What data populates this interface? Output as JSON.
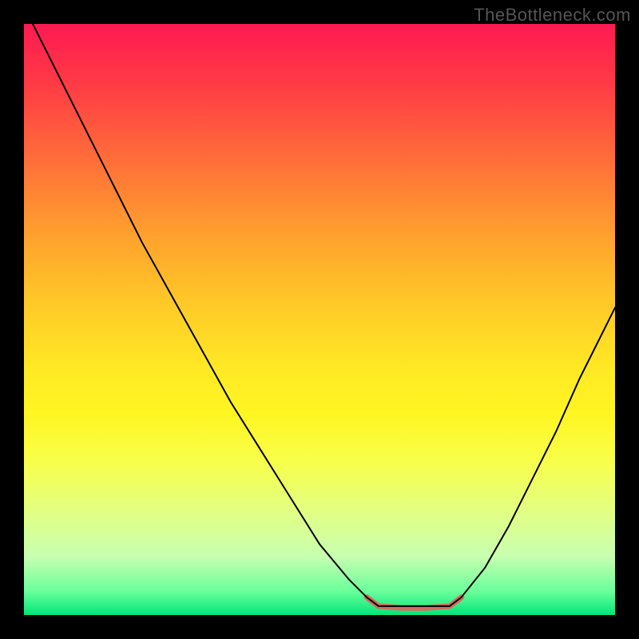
{
  "watermark": "TheBottleneck.com",
  "chart_data": {
    "type": "line",
    "title": "",
    "xlabel": "",
    "ylabel": "",
    "xlim": [
      0,
      100
    ],
    "ylim": [
      0,
      100
    ],
    "legend": null,
    "gradient_stops": [
      {
        "pos": 0,
        "color": "#ff1a52"
      },
      {
        "pos": 10,
        "color": "#ff3a45"
      },
      {
        "pos": 22,
        "color": "#ff6a3a"
      },
      {
        "pos": 34,
        "color": "#ff9a2f"
      },
      {
        "pos": 46,
        "color": "#ffc528"
      },
      {
        "pos": 58,
        "color": "#ffe824"
      },
      {
        "pos": 66,
        "color": "#fff622"
      },
      {
        "pos": 74,
        "color": "#f8ff4a"
      },
      {
        "pos": 82,
        "color": "#e4ff80"
      },
      {
        "pos": 90,
        "color": "#c8ffb0"
      },
      {
        "pos": 96,
        "color": "#6aff9a"
      },
      {
        "pos": 100,
        "color": "#00e67a"
      }
    ],
    "series": [
      {
        "name": "main-curve",
        "color": "#000000",
        "stroke_width": 2,
        "points": [
          {
            "x": 1.5,
            "y": 100
          },
          {
            "x": 5,
            "y": 93
          },
          {
            "x": 10,
            "y": 83
          },
          {
            "x": 15,
            "y": 73
          },
          {
            "x": 20,
            "y": 63
          },
          {
            "x": 25,
            "y": 54
          },
          {
            "x": 30,
            "y": 45
          },
          {
            "x": 35,
            "y": 36
          },
          {
            "x": 40,
            "y": 28
          },
          {
            "x": 45,
            "y": 20
          },
          {
            "x": 50,
            "y": 12
          },
          {
            "x": 55,
            "y": 6
          },
          {
            "x": 58,
            "y": 3
          },
          {
            "x": 60,
            "y": 1.5
          },
          {
            "x": 64,
            "y": 1.5
          },
          {
            "x": 68,
            "y": 1.5
          },
          {
            "x": 72,
            "y": 1.5
          },
          {
            "x": 74,
            "y": 3
          },
          {
            "x": 78,
            "y": 8
          },
          {
            "x": 82,
            "y": 15
          },
          {
            "x": 86,
            "y": 23
          },
          {
            "x": 90,
            "y": 31
          },
          {
            "x": 94,
            "y": 40
          },
          {
            "x": 98,
            "y": 48
          },
          {
            "x": 100,
            "y": 52
          }
        ]
      },
      {
        "name": "valley-highlight",
        "color": "#d86a5f",
        "stroke_width": 7,
        "points": [
          {
            "x": 58,
            "y": 3
          },
          {
            "x": 60,
            "y": 1.5
          },
          {
            "x": 64,
            "y": 1.2
          },
          {
            "x": 68,
            "y": 1.2
          },
          {
            "x": 72,
            "y": 1.5
          },
          {
            "x": 74,
            "y": 3
          }
        ]
      }
    ]
  }
}
